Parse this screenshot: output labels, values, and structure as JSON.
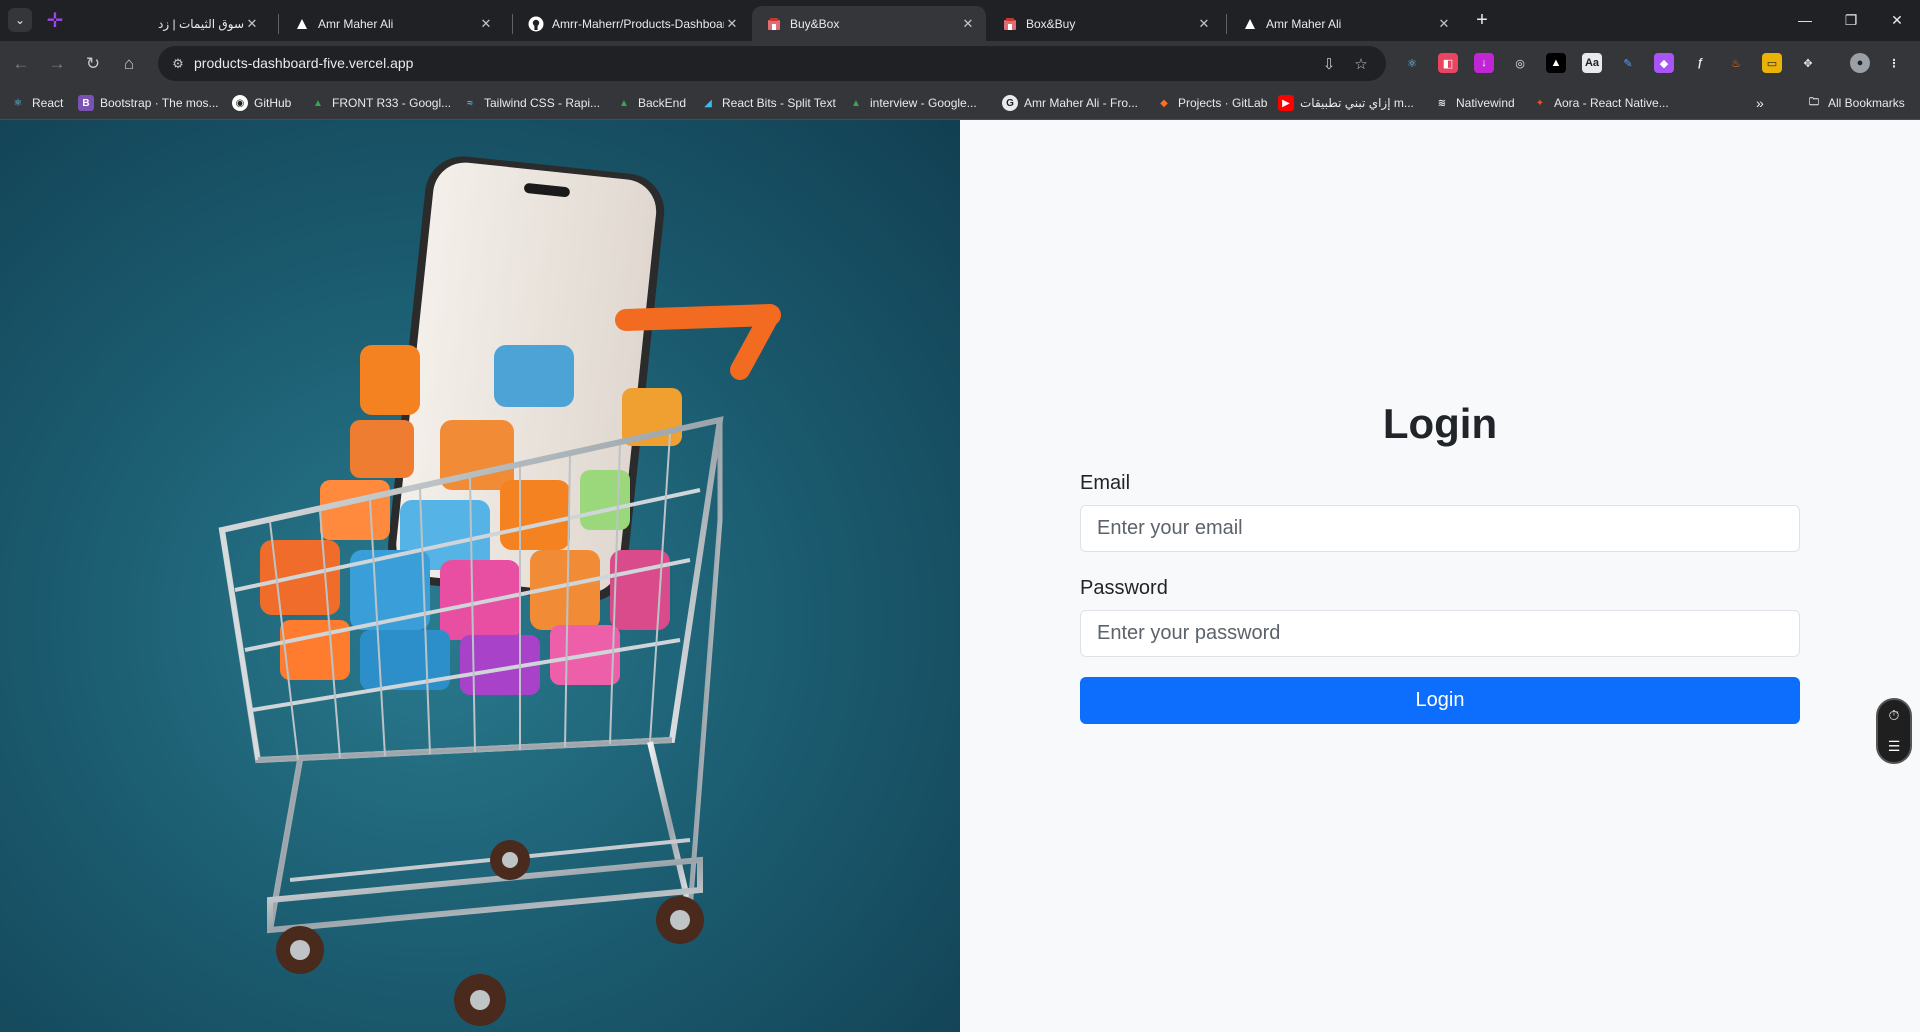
{
  "tabs": [
    {
      "title": "سوق الثيمات | زد",
      "active": false
    },
    {
      "title": "Amr Maher Ali",
      "active": false
    },
    {
      "title": "Amrr-Maherr/Products-Dashboard",
      "active": false
    },
    {
      "title": "Buy&Box",
      "active": true
    },
    {
      "title": "Box&Buy",
      "active": false
    },
    {
      "title": "Amr Maher Ali",
      "active": false
    }
  ],
  "address_bar": {
    "url": "products-dashboard-five.vercel.app"
  },
  "bookmarks": [
    {
      "label": "React"
    },
    {
      "label": "Bootstrap · The mos..."
    },
    {
      "label": "GitHub"
    },
    {
      "label": "FRONT R33 - Googl..."
    },
    {
      "label": "Tailwind CSS - Rapi..."
    },
    {
      "label": "BackEnd"
    },
    {
      "label": "React Bits - Split Text"
    },
    {
      "label": "interview - Google..."
    },
    {
      "label": "Amr Maher Ali - Fro..."
    },
    {
      "label": "Projects · GitLab"
    },
    {
      "label": "إزاي تبني تطبيقات m..."
    },
    {
      "label": "Nativewind"
    },
    {
      "label": "Aora - React Native..."
    }
  ],
  "all_bookmarks_label": "All Bookmarks",
  "login": {
    "title": "Login",
    "email_label": "Email",
    "email_placeholder": "Enter your email",
    "password_label": "Password",
    "password_placeholder": "Enter your password",
    "submit_label": "Login"
  },
  "colors": {
    "primary_button": "#0d6efd",
    "page_background": "#f8f9fa",
    "hero_background": "#1c5e72"
  }
}
